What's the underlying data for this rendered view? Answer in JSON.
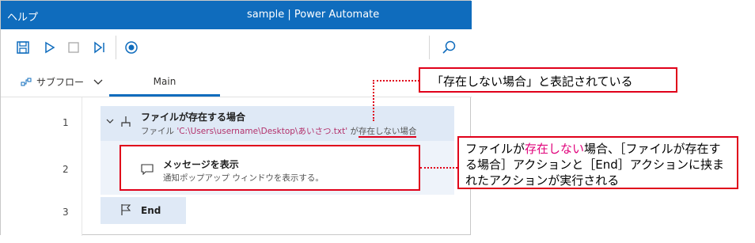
{
  "titlebar": {
    "menu": "ヘルプ",
    "title": "sample | Power Automate"
  },
  "toolbar": {
    "icons": [
      "save-icon",
      "run-icon",
      "stop-icon",
      "step-icon",
      "record-icon",
      "search-icon"
    ]
  },
  "tabs": {
    "subflow_label": "サブフロー",
    "main_label": "Main"
  },
  "line_numbers": [
    "1",
    "2",
    "3"
  ],
  "actions": [
    {
      "title": "ファイルが存在する場合",
      "sub_prefix": "ファイル ",
      "path": "'C:\\Users\\username\\Desktop\\あいさつ.txt'",
      "sub_mid": " が",
      "condition": "存在しない場合"
    },
    {
      "title": "メッセージを表示",
      "sub": "通知ポップアップ ウィンドウを表示する。"
    },
    {
      "title": "End"
    }
  ],
  "annotations": {
    "note1": "「存在しない場合」と表記されている",
    "note2_pre": "ファイルが",
    "note2_highlight": "存在しない",
    "note2_post": "場合、［ファイルが存在する場合］アクションと［End］アクションに挟まれたアクションが実行される"
  },
  "colors": {
    "accent": "#0f6cbd",
    "annotation_red": "#e0001a",
    "highlight_pink": "#e0007a"
  }
}
